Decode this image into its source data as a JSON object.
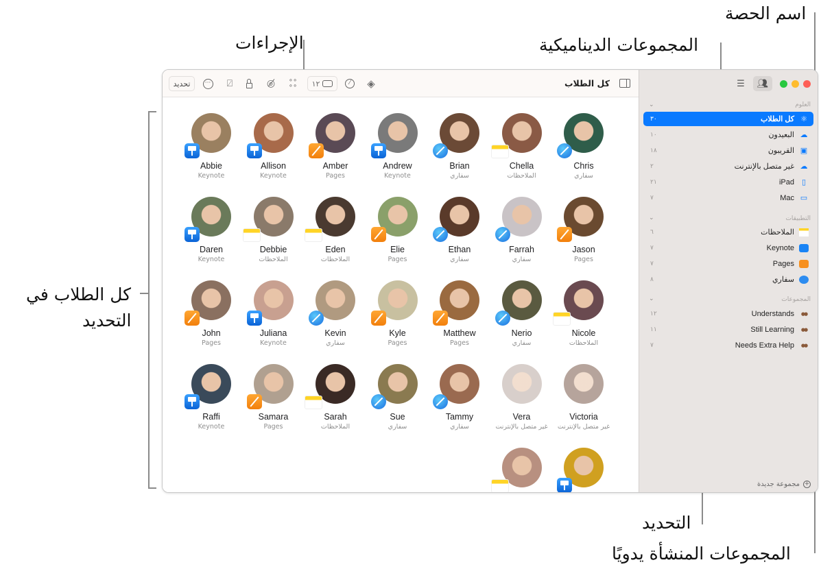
{
  "callouts": {
    "actions": "الإجراءات",
    "class_name": "اسم الحصة",
    "dynamic_groups": "المجموعات الديناميكية",
    "all_students_in_selection_line1": "كل الطلاب في",
    "all_students_in_selection_line2": "التحديد",
    "selection": "التحديد",
    "manual_groups": "المجموعات المنشأة يدويًا"
  },
  "toolbar": {
    "update_label": "تحديد",
    "title": "كل الطلاب",
    "inbox_count": "١٢",
    "icons": [
      "more-icon",
      "hide-pointer-icon",
      "lock-icon",
      "hide-icon",
      "apps-icon",
      "inbox-icon",
      "navigate-icon",
      "layers-icon"
    ]
  },
  "sidebar": {
    "traffic_colors": {
      "close": "#fe5f57",
      "minimize": "#febc2e",
      "zoom": "#28c840"
    },
    "accent": "#0a7aff",
    "class_header": "العلوم",
    "apps_header": "التطبيقات",
    "groups_header": "المجموعات",
    "dynamic": [
      {
        "label": "كل الطلاب",
        "count": "٣٠",
        "icon": "atom-icon",
        "selected": true
      },
      {
        "label": "البعيدون",
        "count": "١٠",
        "icon": "cloud-person-icon"
      },
      {
        "label": "القريبون",
        "count": "١٨",
        "icon": "person-rect-icon"
      },
      {
        "label": "غير متصل بالإنترنت",
        "count": "٢",
        "icon": "cloud-off-icon"
      },
      {
        "label": "iPad",
        "count": "٢١",
        "icon": "ipad-icon"
      },
      {
        "label": "Mac",
        "count": "٧",
        "icon": "laptop-icon"
      }
    ],
    "apps": [
      {
        "label": "الملاحظات",
        "count": "٦",
        "icon": "notes-icon"
      },
      {
        "label": "Keynote",
        "count": "٧",
        "icon": "keynote-icon"
      },
      {
        "label": "Pages",
        "count": "٧",
        "icon": "pages-icon"
      },
      {
        "label": "سفاري",
        "count": "٨",
        "icon": "safari-icon"
      }
    ],
    "groups": [
      {
        "label": "Understands",
        "count": "١٢",
        "icon": "group-avatars-icon"
      },
      {
        "label": "Still Learning",
        "count": "١١",
        "icon": "group-avatars-icon"
      },
      {
        "label": "Needs Extra Help",
        "count": "٧",
        "icon": "group-avatars-icon"
      }
    ],
    "new_group_label": "مجموعة جديدة"
  },
  "students": [
    {
      "name": "Chris",
      "app": "سفاري",
      "badge": "safari",
      "color": "#2f5d4a"
    },
    {
      "name": "Chella",
      "app": "الملاحظات",
      "badge": "notes",
      "color": "#8a5a45"
    },
    {
      "name": "Brian",
      "app": "سفاري",
      "badge": "safari",
      "color": "#6b4a36"
    },
    {
      "name": "Andrew",
      "app": "Keynote",
      "badge": "keynote",
      "color": "#7a7a7a"
    },
    {
      "name": "Amber",
      "app": "Pages",
      "badge": "pages",
      "color": "#5a4a55"
    },
    {
      "name": "Allison",
      "app": "Keynote",
      "badge": "keynote",
      "color": "#a86a4a"
    },
    {
      "name": "Abbie",
      "app": "Keynote",
      "badge": "keynote",
      "color": "#9a8060"
    },
    {
      "name": "Jason",
      "app": "Pages",
      "badge": "pages",
      "color": "#6a4a30"
    },
    {
      "name": "Farrah",
      "app": "سفاري",
      "badge": "safari",
      "color": "#c9c3c6"
    },
    {
      "name": "Ethan",
      "app": "سفاري",
      "badge": "safari",
      "color": "#5a3a2a"
    },
    {
      "name": "Elie",
      "app": "Pages",
      "badge": "pages",
      "color": "#8aa06a"
    },
    {
      "name": "Eden",
      "app": "الملاحظات",
      "badge": "notes",
      "color": "#4a3a30"
    },
    {
      "name": "Debbie",
      "app": "الملاحظات",
      "badge": "notes",
      "color": "#8a7a6a"
    },
    {
      "name": "Daren",
      "app": "Keynote",
      "badge": "keynote",
      "color": "#6a7a5a"
    },
    {
      "name": "Nicole",
      "app": "الملاحظات",
      "badge": "notes",
      "color": "#6a4a50"
    },
    {
      "name": "Nerio",
      "app": "سفاري",
      "badge": "safari",
      "color": "#5a5a40"
    },
    {
      "name": "Matthew",
      "app": "Pages",
      "badge": "pages",
      "color": "#9a6a40"
    },
    {
      "name": "Kyle",
      "app": "Pages",
      "badge": "pages",
      "color": "#c8c0a0"
    },
    {
      "name": "Kevin",
      "app": "سفاري",
      "badge": "safari",
      "color": "#b09a80"
    },
    {
      "name": "Juliana",
      "app": "Keynote",
      "badge": "keynote",
      "color": "#c8a090"
    },
    {
      "name": "John",
      "app": "Pages",
      "badge": "pages",
      "color": "#8a7060"
    },
    {
      "name": "Victoria",
      "app": "غير متصل بالإنترنت",
      "badge": "none",
      "color": "#7a5a4a",
      "offline": true
    },
    {
      "name": "Vera",
      "app": "غير متصل بالإنترنت",
      "badge": "none",
      "color": "#b8a8a0",
      "offline": true
    },
    {
      "name": "Tammy",
      "app": "سفاري",
      "badge": "safari",
      "color": "#9a6a50"
    },
    {
      "name": "Sue",
      "app": "سفاري",
      "badge": "safari",
      "color": "#8a7a50"
    },
    {
      "name": "Sarah",
      "app": "الملاحظات",
      "badge": "notes",
      "color": "#3a2a25"
    },
    {
      "name": "Samara",
      "app": "Pages",
      "badge": "pages",
      "color": "#b0a090"
    },
    {
      "name": "Raffi",
      "app": "Keynote",
      "badge": "keynote",
      "color": "#3a4a5a"
    },
    {
      "name": "",
      "app": "",
      "badge": "keynote",
      "color": "#d0a020"
    },
    {
      "name": "",
      "app": "",
      "badge": "notes",
      "color": "#b89080"
    }
  ]
}
